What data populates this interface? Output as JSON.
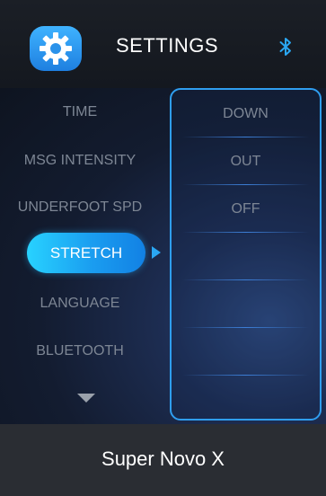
{
  "header": {
    "title": "SETTINGS",
    "settings_icon": "gear-icon",
    "bluetooth_icon": "bluetooth-icon"
  },
  "menu": {
    "items": [
      {
        "label": "TIME"
      },
      {
        "label": "MSG INTENSITY"
      },
      {
        "label": "UNDERFOOT SPD"
      },
      {
        "label": "STRETCH",
        "selected": true
      },
      {
        "label": "LANGUAGE"
      },
      {
        "label": "BLUETOOTH"
      }
    ],
    "more_icon": "chevron-down-icon",
    "selected_arrow_icon": "arrow-right-icon"
  },
  "options": {
    "items": [
      {
        "label": "DOWN"
      },
      {
        "label": "OUT"
      },
      {
        "label": "OFF"
      }
    ]
  },
  "footer": {
    "device_name": "Super Novo X"
  },
  "colors": {
    "accent": "#2aa6f2",
    "selected_start": "#28d2ff",
    "selected_end": "#1281e4",
    "text_muted": "#7d8694",
    "text_primary": "#ffffff",
    "footer_bg": "#2a2d33"
  }
}
